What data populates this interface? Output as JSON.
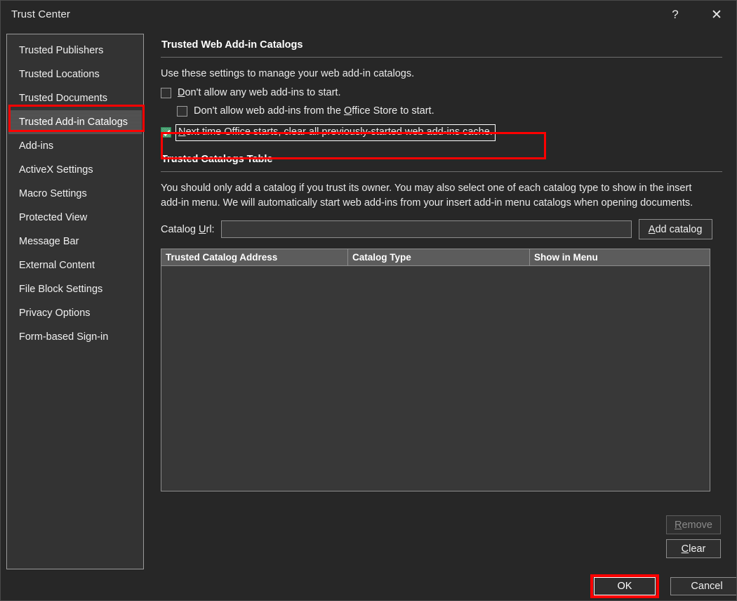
{
  "window": {
    "title": "Trust Center",
    "help_glyph": "?",
    "close_glyph": "✕"
  },
  "sidebar": {
    "items": [
      {
        "label": "Trusted Publishers",
        "selected": false
      },
      {
        "label": "Trusted Locations",
        "selected": false
      },
      {
        "label": "Trusted Documents",
        "selected": false
      },
      {
        "label": "Trusted Add-in Catalogs",
        "selected": true
      },
      {
        "label": "Add-ins",
        "selected": false
      },
      {
        "label": "ActiveX Settings",
        "selected": false
      },
      {
        "label": "Macro Settings",
        "selected": false
      },
      {
        "label": "Protected View",
        "selected": false
      },
      {
        "label": "Message Bar",
        "selected": false
      },
      {
        "label": "External Content",
        "selected": false
      },
      {
        "label": "File Block Settings",
        "selected": false
      },
      {
        "label": "Privacy Options",
        "selected": false
      },
      {
        "label": "Form-based Sign-in",
        "selected": false
      }
    ]
  },
  "main": {
    "section1": {
      "title": "Trusted Web Add-in Catalogs",
      "intro": "Use these settings to manage your web add-in catalogs.",
      "checkbox1": {
        "label_pre": "",
        "label_accel": "D",
        "label_post": "on't allow any web add-ins to start.",
        "checked": false
      },
      "checkbox2": {
        "label_pre": "Don't allow web add-ins from the ",
        "label_accel": "O",
        "label_post": "ffice Store to start.",
        "checked": false
      },
      "checkbox3": {
        "label_pre": "",
        "label_accel": "N",
        "label_post": "ext time Office starts, clear all previously-started web add-ins cache.",
        "checked": true,
        "focused": true
      }
    },
    "section2": {
      "title": "Trusted Catalogs Table",
      "description": "You should only add a catalog if you trust its owner. You may also select one of each catalog type to show in the insert add-in menu. We will automatically start web add-ins from your insert add-in menu catalogs when opening documents.",
      "url_label_pre": "Catalog ",
      "url_label_accel": "U",
      "url_label_post": "rl:",
      "url_value": "",
      "url_placeholder": "",
      "add_catalog": {
        "label_pre": "",
        "label_accel": "A",
        "label_post": "dd catalog"
      },
      "table": {
        "columns": [
          "Trusted Catalog Address",
          "Catalog Type",
          "Show in Menu"
        ],
        "rows": []
      },
      "remove_button": {
        "label_pre": "",
        "label_accel": "R",
        "label_post": "emove",
        "enabled": false
      },
      "clear_button": {
        "label_pre": "",
        "label_accel": "C",
        "label_post": "lear",
        "enabled": true
      }
    }
  },
  "footer": {
    "ok_label": "OK",
    "cancel_label": "Cancel"
  },
  "colors": {
    "dialog_bg": "#272727",
    "sidebar_bg": "#333333",
    "selected_item_bg": "#4e4e4e",
    "highlight_red": "#fe0000",
    "checkbox_checked": "#3f9b6a",
    "table_header_bg": "#5c5c5c",
    "text": "#f0f0f0",
    "disabled_text": "#8a8a8a"
  }
}
